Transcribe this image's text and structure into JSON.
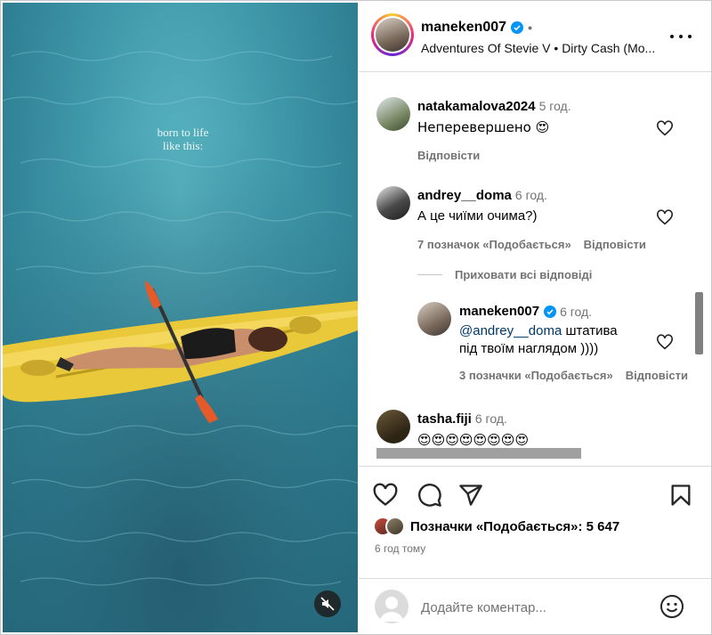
{
  "media": {
    "overlay_text_line1": "born to life",
    "overlay_text_line2": "like this:"
  },
  "header": {
    "username": "maneken007",
    "separator": "•",
    "audio": "Adventures Of Stevie V • Dirty Cash (Mo..."
  },
  "comments": [
    {
      "username": "natakamalova2024",
      "time": "5 год.",
      "text": "Неперевершено 😍",
      "reply_label": "Відповісти"
    },
    {
      "username": "andrey__doma",
      "time": "6 год.",
      "text": "А це чиїми очима?)",
      "likes_label": "7 позначок «Подобається»",
      "reply_label": "Відповісти"
    }
  ],
  "hide_replies_label": "Приховати всі відповіді",
  "reply": {
    "username": "maneken007",
    "time": "6 год.",
    "mention": "@andrey__doma",
    "text_after_mention": " штатива",
    "text_line2": "під твоїм наглядом ))))",
    "likes_label": "3 позначки «Подобається»",
    "reply_label": "Відповісти"
  },
  "last_comment": {
    "username": "tasha.fiji",
    "time": "6 год.",
    "text": "😍😍😍😍😍😍😍😍"
  },
  "likes": {
    "label": "Позначки «Подобається»: 5 647"
  },
  "post_time": "6 год тому",
  "add_comment": {
    "placeholder": "Додайте коментар..."
  },
  "colors": {
    "verified_blue": "#0095f6",
    "secondary_text": "#737373",
    "divider": "#dbdbdb"
  },
  "icons": [
    "mute-icon",
    "verified-icon",
    "more-icon",
    "heart-icon",
    "comment-icon",
    "share-icon",
    "bookmark-icon",
    "emoji-icon"
  ]
}
